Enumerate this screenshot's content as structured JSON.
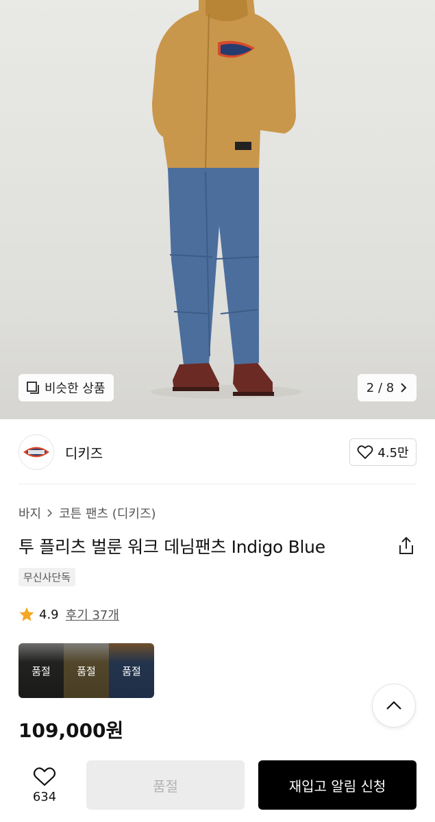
{
  "hero": {
    "similar_label": "비슷한 상품",
    "pager_text": "2 / 8",
    "colors": {
      "background": "#e4e4e1",
      "jacket": "#c9974b",
      "denim": "#4c6e9c",
      "boots": "#6b2a24"
    }
  },
  "brand": {
    "name": "디키즈",
    "logo_text": "Dickies",
    "likes": "4.5만"
  },
  "breadcrumb": {
    "category": "바지",
    "subcategory": "코튼 팬츠 (디키즈)"
  },
  "product": {
    "title": "투 플리츠 벌룬 워크 데님팬츠 Indigo Blue",
    "tag": "무신사단독",
    "rating": "4.9",
    "reviews": "후기 37개",
    "price": "109,000원"
  },
  "colors_options": [
    {
      "label": "품절",
      "swatch": "#3a3b38"
    },
    {
      "label": "품절",
      "swatch": "#8e7a4a"
    },
    {
      "label": "품절",
      "swatch": "#3d5a84"
    }
  ],
  "bottom": {
    "wish_count": "634",
    "soldout_label": "품절",
    "restock_label": "재입고 알림 신청"
  },
  "accent": {
    "star": "#f5a623",
    "primary_button": "#000000"
  }
}
